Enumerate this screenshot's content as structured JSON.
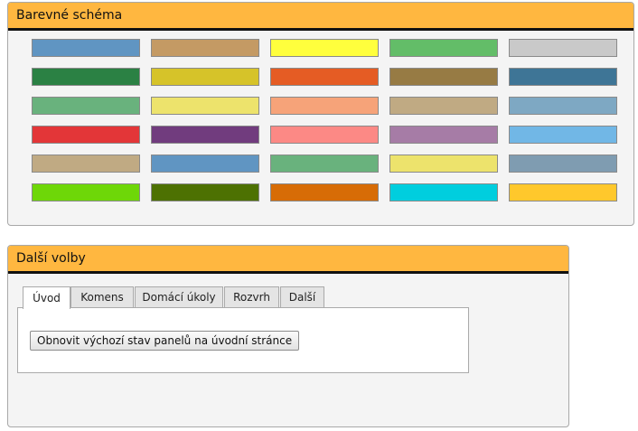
{
  "color_scheme": {
    "title": "Barevné schéma",
    "swatches": [
      [
        "#6095c2",
        "#c49a64",
        "#ffff3d",
        "#63bd68",
        "#c9c9c9"
      ],
      [
        "#2b8144",
        "#d6c329",
        "#e55c24",
        "#977b44",
        "#3e7596"
      ],
      [
        "#69b27d",
        "#ede36c",
        "#f6a379",
        "#c0aa83",
        "#7ea8c3"
      ],
      [
        "#e33638",
        "#713c7e",
        "#fc8985",
        "#a67ca6",
        "#71b7e6"
      ],
      [
        "#c0aa83",
        "#6095c2",
        "#69b27d",
        "#ede36c",
        "#7f9cb1"
      ],
      [
        "#6ed708",
        "#4d7102",
        "#d76c06",
        "#00cede",
        "#ffc82c"
      ]
    ]
  },
  "more_options": {
    "title": "Další volby",
    "tabs": [
      {
        "label": "Úvod",
        "active": true
      },
      {
        "label": "Komens",
        "active": false
      },
      {
        "label": "Domácí úkoly",
        "active": false
      },
      {
        "label": "Rozvrh",
        "active": false
      },
      {
        "label": "Další",
        "active": false
      }
    ],
    "reset_button_label": "Obnovit výchozí stav panelů na úvodní stránce"
  }
}
